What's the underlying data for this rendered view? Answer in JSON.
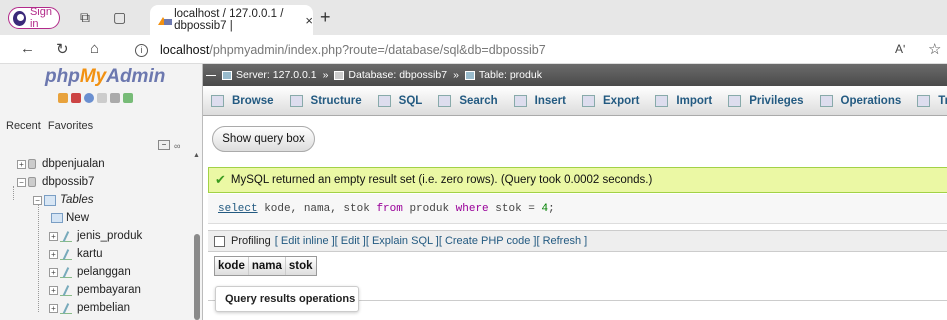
{
  "browser": {
    "sign_in": "Sign in",
    "tab_title": "localhost / 127.0.0.1 / dbpossib7 |",
    "tab_close": "×",
    "new_tab": "+",
    "url_host": "localhost",
    "url_path": "/phpmyadmin/index.php?route=/database/sql&db=dbpossib7",
    "read_aloud": "Aʹ",
    "favorite": "☆"
  },
  "sidebar": {
    "logo_php": "php",
    "logo_my": "My",
    "logo_admin": "Admin",
    "recent": "Recent",
    "favorites": "Favorites",
    "tree": [
      {
        "label": "dbpenjualan",
        "type": "db"
      },
      {
        "label": "dbpossib7",
        "type": "db"
      },
      {
        "label": "Tables",
        "type": "folder"
      },
      {
        "label": "New",
        "type": "new"
      },
      {
        "label": "jenis_produk",
        "type": "table"
      },
      {
        "label": "kartu",
        "type": "table"
      },
      {
        "label": "pelanggan",
        "type": "table"
      },
      {
        "label": "pembayaran",
        "type": "table"
      },
      {
        "label": "pembelian",
        "type": "table"
      }
    ]
  },
  "breadcrumb": {
    "server": "Server: 127.0.0.1",
    "database": "Database: dbpossib7",
    "table": "Table: produk",
    "separator": "»"
  },
  "menu": [
    "Browse",
    "Structure",
    "SQL",
    "Search",
    "Insert",
    "Export",
    "Import",
    "Privileges",
    "Operations",
    "Trig"
  ],
  "show_query_box": "Show query box",
  "success_message": "MySQL returned an empty result set (i.e. zero rows). (Query took 0.0002 seconds.)",
  "sql": {
    "select": "select",
    "cols": " kode, nama, stok ",
    "from": "from",
    "table": " produk ",
    "where": "where",
    "cond": " stok = ",
    "num": "4",
    "end": ";"
  },
  "profiling": {
    "label": "Profiling",
    "links": [
      "[ Edit inline ]",
      "[ Edit ]",
      "[ Explain SQL ]",
      "[ Create PHP code ]",
      "[ Refresh ]"
    ]
  },
  "result_columns": [
    "kode",
    "nama",
    "stok"
  ],
  "query_results_operations": "Query results operations"
}
